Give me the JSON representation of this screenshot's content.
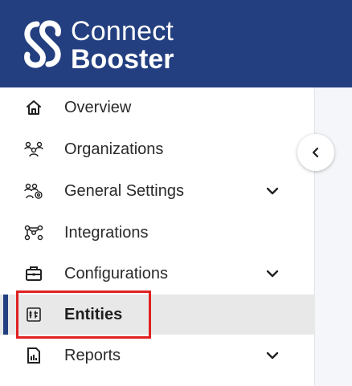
{
  "brand": {
    "line1": "Connect",
    "line2": "Booster",
    "logo_icon": "connectbooster-logo",
    "bar_color": "#233f80"
  },
  "sidebar": {
    "collapse_icon": "chevron-left-icon",
    "items": [
      {
        "label": "Overview",
        "icon": "home-icon",
        "expandable": false,
        "active": false
      },
      {
        "label": "Organizations",
        "icon": "organizations-icon",
        "expandable": false,
        "active": false
      },
      {
        "label": "General Settings",
        "icon": "general-settings-icon",
        "expandable": true,
        "active": false
      },
      {
        "label": "Integrations",
        "icon": "integrations-icon",
        "expandable": false,
        "active": false
      },
      {
        "label": "Configurations",
        "icon": "configurations-icon",
        "expandable": true,
        "active": false
      },
      {
        "label": "Entities",
        "icon": "entities-icon",
        "expandable": false,
        "active": true
      },
      {
        "label": "Reports",
        "icon": "reports-icon",
        "expandable": true,
        "active": false
      }
    ]
  },
  "highlight_color": "#e02020"
}
